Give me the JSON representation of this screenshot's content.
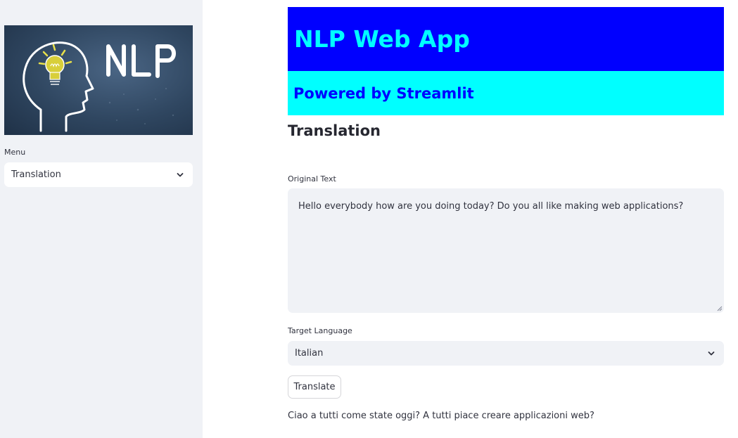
{
  "sidebar": {
    "logo_text": "NLP",
    "menu": {
      "label": "Menu",
      "selected": "Translation",
      "icon": "chevron-down-icon"
    }
  },
  "header": {
    "title": "NLP Web App",
    "subtitle": "Powered by Streamlit",
    "title_bg": "#0000ff",
    "title_color": "#00ffff",
    "subtitle_bg": "#00ffff",
    "subtitle_color": "#0000ff"
  },
  "main": {
    "section_title": "Translation",
    "original_text": {
      "label": "Original Text",
      "value": "Hello everybody how are you doing today? Do you all like making web applications?"
    },
    "target_language": {
      "label": "Target Language",
      "selected": "Italian",
      "icon": "chevron-down-icon"
    },
    "translate_button": "Translate",
    "result": "Ciao a tutti come state oggi? A tutti piace creare applicazioni web?"
  }
}
